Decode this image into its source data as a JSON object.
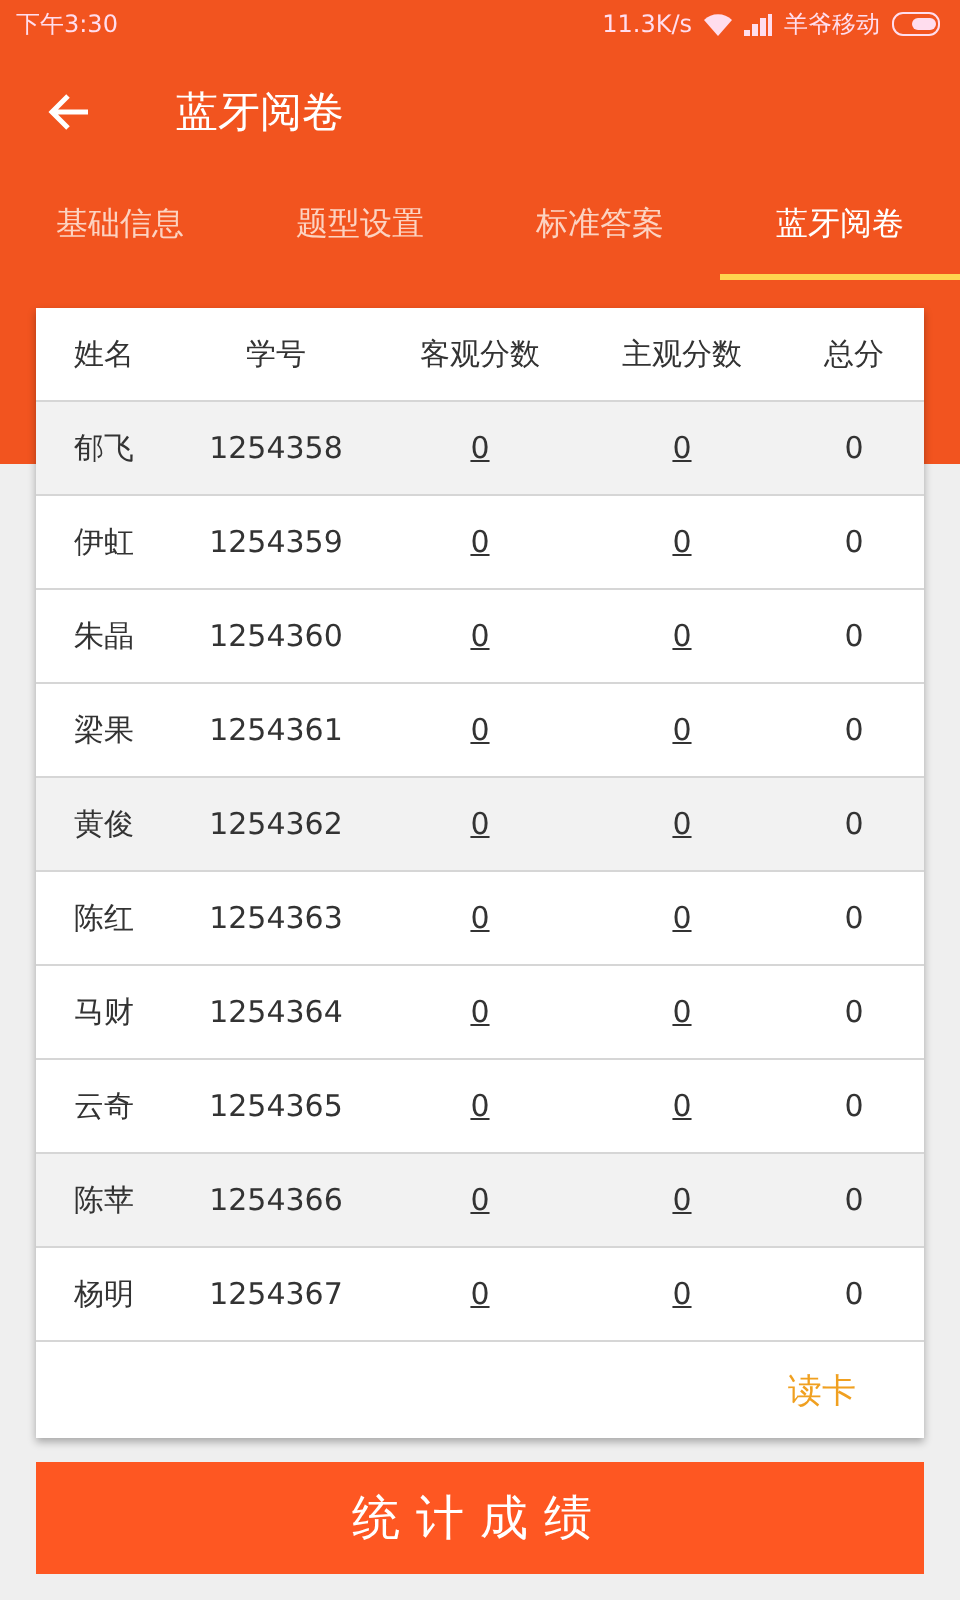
{
  "status_bar": {
    "time": "下午3:30",
    "speed": "11.3K/s",
    "carrier": "羊爷移动"
  },
  "toolbar": {
    "title": "蓝牙阅卷"
  },
  "tabs": [
    {
      "label": "基础信息",
      "selected": false
    },
    {
      "label": "题型设置",
      "selected": false
    },
    {
      "label": "标准答案",
      "selected": false
    },
    {
      "label": "蓝牙阅卷",
      "selected": true
    }
  ],
  "table": {
    "columns": [
      "姓名",
      "学号",
      "客观分数",
      "主观分数",
      "总分"
    ],
    "rows": [
      {
        "name": "郁飞",
        "id": "1254358",
        "objective": "0",
        "subjective": "0",
        "total": "0",
        "highlighted": true
      },
      {
        "name": "伊虹",
        "id": "1254359",
        "objective": "0",
        "subjective": "0",
        "total": "0",
        "highlighted": false
      },
      {
        "name": "朱晶",
        "id": "1254360",
        "objective": "0",
        "subjective": "0",
        "total": "0",
        "highlighted": false
      },
      {
        "name": "梁果",
        "id": "1254361",
        "objective": "0",
        "subjective": "0",
        "total": "0",
        "highlighted": false
      },
      {
        "name": "黄俊",
        "id": "1254362",
        "objective": "0",
        "subjective": "0",
        "total": "0",
        "highlighted": true
      },
      {
        "name": "陈红",
        "id": "1254363",
        "objective": "0",
        "subjective": "0",
        "total": "0",
        "highlighted": false
      },
      {
        "name": "马财",
        "id": "1254364",
        "objective": "0",
        "subjective": "0",
        "total": "0",
        "highlighted": false
      },
      {
        "name": "云奇",
        "id": "1254365",
        "objective": "0",
        "subjective": "0",
        "total": "0",
        "highlighted": false
      },
      {
        "name": "陈苹",
        "id": "1254366",
        "objective": "0",
        "subjective": "0",
        "total": "0",
        "highlighted": true
      },
      {
        "name": "杨明",
        "id": "1254367",
        "objective": "0",
        "subjective": "0",
        "total": "0",
        "highlighted": false
      }
    ],
    "read_card_link": "读卡"
  },
  "stats_button": "统计成绩"
}
